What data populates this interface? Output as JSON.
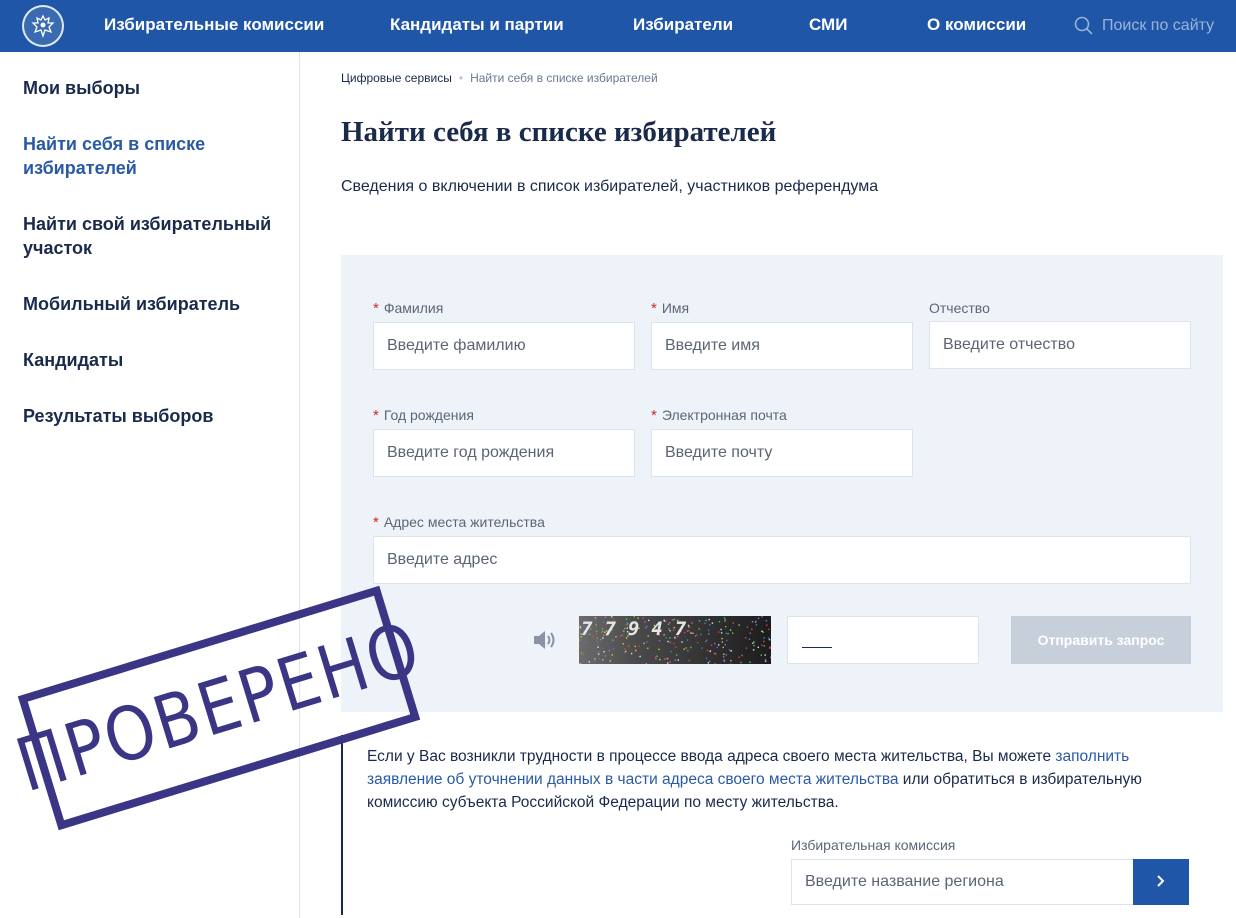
{
  "header": {
    "nav": [
      {
        "label": "Избирательные комиссии"
      },
      {
        "label": "Кандидаты и партии"
      },
      {
        "label": "Избиратели"
      },
      {
        "label": "СМИ"
      },
      {
        "label": "О комиссии"
      }
    ],
    "search_placeholder": "Поиск по сайту",
    "bg_color": "#1f56a8"
  },
  "sidebar": {
    "items": [
      {
        "label": "Мои выборы",
        "active": false
      },
      {
        "label": "Найти себя в списке избирателей",
        "active": true
      },
      {
        "label": "Найти свой избирательный участок",
        "active": false
      },
      {
        "label": "Мобильный избиратель",
        "active": false
      },
      {
        "label": "Кандидаты",
        "active": false
      },
      {
        "label": "Результаты выборов",
        "active": false
      }
    ]
  },
  "breadcrumb": {
    "parent": "Цифровые сервисы",
    "separator": "•",
    "current": "Найти себя в списке избирателей"
  },
  "page": {
    "title": "Найти себя в списке избирателей",
    "subtitle": "Сведения о включении в список избирателей, участников референдума"
  },
  "form": {
    "required_mark": "*",
    "lastname": {
      "label": "Фамилия",
      "placeholder": "Введите фамилию"
    },
    "firstname": {
      "label": "Имя",
      "placeholder": "Введите имя"
    },
    "patronymic": {
      "label": "Отчество",
      "placeholder": "Введите отчество"
    },
    "birth_year": {
      "label": "Год рождения",
      "placeholder": "Введите год рождения"
    },
    "email": {
      "label": "Электронная почта",
      "placeholder": "Введите почту"
    },
    "address": {
      "label": "Адрес места жительства",
      "placeholder": "Введите адрес"
    },
    "captcha_text": "77947",
    "submit_label": "Отправить запрос"
  },
  "info": {
    "text_before": "Если у Вас возникли трудности в процессе ввода адреса своего места жительства, Вы можете ",
    "link_text": "заполнить заявление об уточнении данных в части адреса своего места жительства",
    "text_after": " или обратиться в избирательную комиссию субъекта Российской Федерации по месту жительства."
  },
  "commission": {
    "label": "Избирательная комиссия",
    "placeholder": "Введите название региона"
  },
  "stamp": {
    "text": "ПРОВЕРЕНО",
    "color": "#3b3586"
  },
  "colors": {
    "accent": "#1f56a8",
    "link": "#2a5aa4",
    "required": "#cf2a2a",
    "panel": "#eef3f9"
  }
}
